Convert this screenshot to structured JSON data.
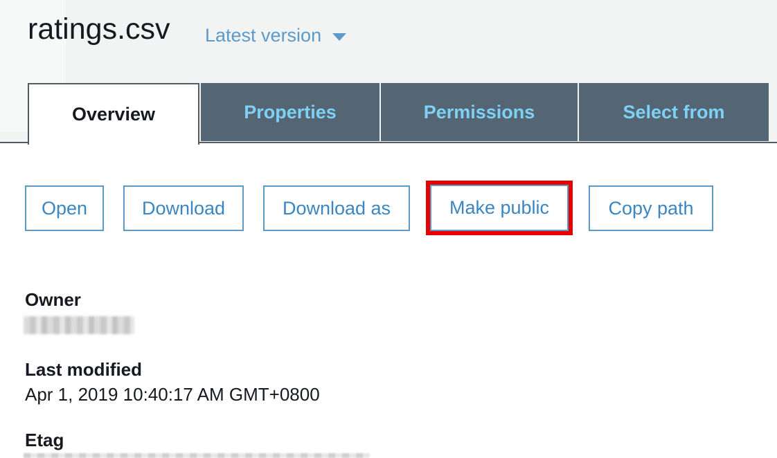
{
  "header": {
    "file_name": "ratings.csv",
    "version_label": "Latest version"
  },
  "tabs": [
    {
      "label": "Overview",
      "active": true
    },
    {
      "label": "Properties",
      "active": false
    },
    {
      "label": "Permissions",
      "active": false
    },
    {
      "label": "Select from",
      "active": false
    }
  ],
  "actions": {
    "open": "Open",
    "download": "Download",
    "download_as": "Download as",
    "make_public": "Make public",
    "copy_path": "Copy path"
  },
  "details": {
    "owner_label": "Owner",
    "last_modified_label": "Last modified",
    "last_modified_value": "Apr 1, 2019 10:40:17 AM GMT+0800",
    "etag_label": "Etag"
  },
  "colors": {
    "accent": "#5b9ac9",
    "tab_bg": "#546673",
    "tab_text": "#7fd0f5",
    "highlight": "#e60000"
  },
  "icons": {
    "version_caret": "caret-down-icon"
  }
}
